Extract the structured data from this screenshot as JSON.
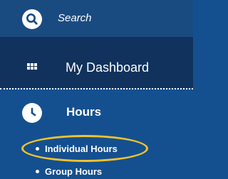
{
  "search": {
    "label": "Search"
  },
  "nav": {
    "dashboard": {
      "label": "My Dashboard"
    },
    "hours": {
      "label": "Hours",
      "items": [
        {
          "label": "Individual Hours"
        },
        {
          "label": "Group Hours"
        }
      ]
    }
  },
  "colors": {
    "header": "#1a4b80",
    "dashboard_bg": "#10325c",
    "background": "#14508f",
    "highlight": "#f2c230"
  },
  "icons": {
    "search": "search-icon",
    "dashboard": "grid-icon",
    "hours": "clock-icon"
  }
}
